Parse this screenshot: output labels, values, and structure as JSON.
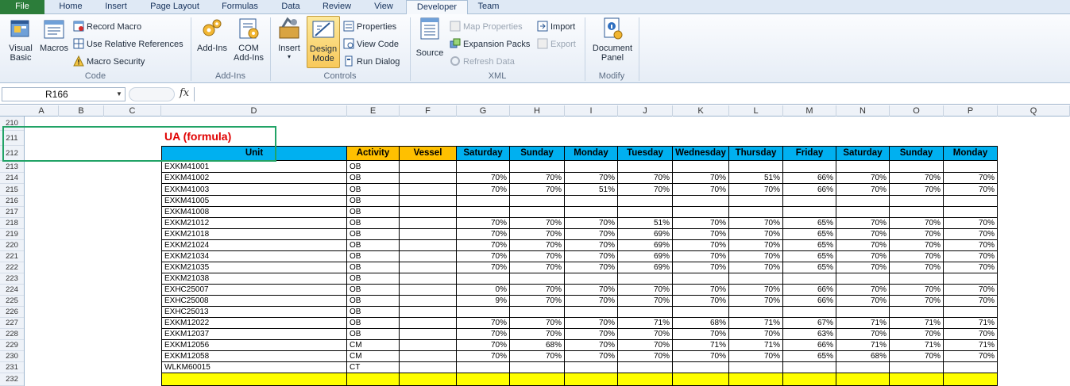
{
  "ribbon": {
    "tabs": [
      "File",
      "Home",
      "Insert",
      "Page Layout",
      "Formulas",
      "Data",
      "Review",
      "View",
      "Developer",
      "Team"
    ],
    "active_tab": "Developer",
    "groups": {
      "code": {
        "label": "Code",
        "visual_basic": "Visual\nBasic",
        "visual_basic_l1": "Visual",
        "visual_basic_l2": "Basic",
        "macros": "Macros",
        "record_macro": "Record Macro",
        "relative_refs": "Use Relative References",
        "macro_security": "Macro Security"
      },
      "addins": {
        "label": "Add-Ins",
        "addins": "Add-Ins",
        "com_l1": "COM",
        "com_l2": "Add-Ins"
      },
      "controls": {
        "label": "Controls",
        "insert": "Insert",
        "design_l1": "Design",
        "design_l2": "Mode",
        "properties": "Properties",
        "view_code": "View Code",
        "run_dialog": "Run Dialog"
      },
      "xml": {
        "label": "XML",
        "source": "Source",
        "map_properties": "Map Properties",
        "expansion_packs": "Expansion Packs",
        "refresh_data": "Refresh Data",
        "import": "Import",
        "export": "Export"
      },
      "modify": {
        "label": "Modify",
        "doc_l1": "Document",
        "doc_l2": "Panel"
      }
    }
  },
  "formula_bar": {
    "name_box": "R166",
    "fx": "fx",
    "formula": ""
  },
  "sheet": {
    "columns": [
      "A",
      "B",
      "C",
      "D",
      "E",
      "F",
      "G",
      "H",
      "I",
      "J",
      "K",
      "L",
      "M",
      "N",
      "O",
      "P",
      "Q"
    ],
    "rows": [
      "210",
      "211",
      "212",
      "213",
      "214",
      "215",
      "216",
      "217",
      "218",
      "219",
      "220",
      "221",
      "222",
      "223",
      "224",
      "225",
      "226",
      "227",
      "228",
      "229",
      "230",
      "231",
      "232"
    ],
    "title": "UA  (formula)",
    "table_headers": [
      "Unit",
      "Activity",
      "Vessel",
      "Saturday",
      "Sunday",
      "Monday",
      "Tuesday",
      "Wednesday",
      "Thursday",
      "Friday",
      "Saturday",
      "Sunday",
      "Monday"
    ],
    "table_rows": [
      [
        "EXKM41001",
        "OB",
        "",
        "",
        "",
        "",
        "",
        "",
        "",
        "",
        "",
        "",
        ""
      ],
      [
        "EXKM41002",
        "OB",
        "",
        "70%",
        "70%",
        "70%",
        "70%",
        "70%",
        "51%",
        "66%",
        "70%",
        "70%",
        "70%"
      ],
      [
        "EXKM41003",
        "OB",
        "",
        "70%",
        "70%",
        "51%",
        "70%",
        "70%",
        "70%",
        "66%",
        "70%",
        "70%",
        "70%"
      ],
      [
        "EXKM41005",
        "OB",
        "",
        "",
        "",
        "",
        "",
        "",
        "",
        "",
        "",
        "",
        ""
      ],
      [
        "EXKM41008",
        "OB",
        "",
        "",
        "",
        "",
        "",
        "",
        "",
        "",
        "",
        "",
        ""
      ],
      [
        "EXKM21012",
        "OB",
        "",
        "70%",
        "70%",
        "70%",
        "51%",
        "70%",
        "70%",
        "65%",
        "70%",
        "70%",
        "70%"
      ],
      [
        "EXKM21018",
        "OB",
        "",
        "70%",
        "70%",
        "70%",
        "69%",
        "70%",
        "70%",
        "65%",
        "70%",
        "70%",
        "70%"
      ],
      [
        "EXKM21024",
        "OB",
        "",
        "70%",
        "70%",
        "70%",
        "69%",
        "70%",
        "70%",
        "65%",
        "70%",
        "70%",
        "70%"
      ],
      [
        "EXKM21034",
        "OB",
        "",
        "70%",
        "70%",
        "70%",
        "69%",
        "70%",
        "70%",
        "65%",
        "70%",
        "70%",
        "70%"
      ],
      [
        "EXKM21035",
        "OB",
        "",
        "70%",
        "70%",
        "70%",
        "69%",
        "70%",
        "70%",
        "65%",
        "70%",
        "70%",
        "70%"
      ],
      [
        "EXKM21038",
        "OB",
        "",
        "",
        "",
        "",
        "",
        "",
        "",
        "",
        "",
        "",
        ""
      ],
      [
        "EXHC25007",
        "OB",
        "",
        "0%",
        "70%",
        "70%",
        "70%",
        "70%",
        "70%",
        "66%",
        "70%",
        "70%",
        "70%"
      ],
      [
        "EXHC25008",
        "OB",
        "",
        "9%",
        "70%",
        "70%",
        "70%",
        "70%",
        "70%",
        "66%",
        "70%",
        "70%",
        "70%"
      ],
      [
        "EXHC25013",
        "OB",
        "",
        "",
        "",
        "",
        "",
        "",
        "",
        "",
        "",
        "",
        ""
      ],
      [
        "EXKM12022",
        "OB",
        "",
        "70%",
        "70%",
        "70%",
        "71%",
        "68%",
        "71%",
        "67%",
        "71%",
        "71%",
        "71%"
      ],
      [
        "EXKM12037",
        "OB",
        "",
        "70%",
        "70%",
        "70%",
        "70%",
        "70%",
        "70%",
        "63%",
        "70%",
        "70%",
        "70%"
      ],
      [
        "EXKM12056",
        "CM",
        "",
        "70%",
        "68%",
        "70%",
        "70%",
        "71%",
        "71%",
        "66%",
        "71%",
        "71%",
        "71%"
      ],
      [
        "EXKM12058",
        "CM",
        "",
        "70%",
        "70%",
        "70%",
        "70%",
        "70%",
        "70%",
        "65%",
        "68%",
        "70%",
        "70%"
      ],
      [
        "WLKM60015",
        "CT",
        "",
        "",
        "",
        "",
        "",
        "",
        "",
        "",
        "",
        "",
        ""
      ]
    ],
    "colors": {
      "header_blue": "#00b0f0",
      "header_orange": "#ffc000",
      "total_yellow": "#ffff00",
      "title_red": "#e00000",
      "selection_green": "#21a366"
    }
  }
}
